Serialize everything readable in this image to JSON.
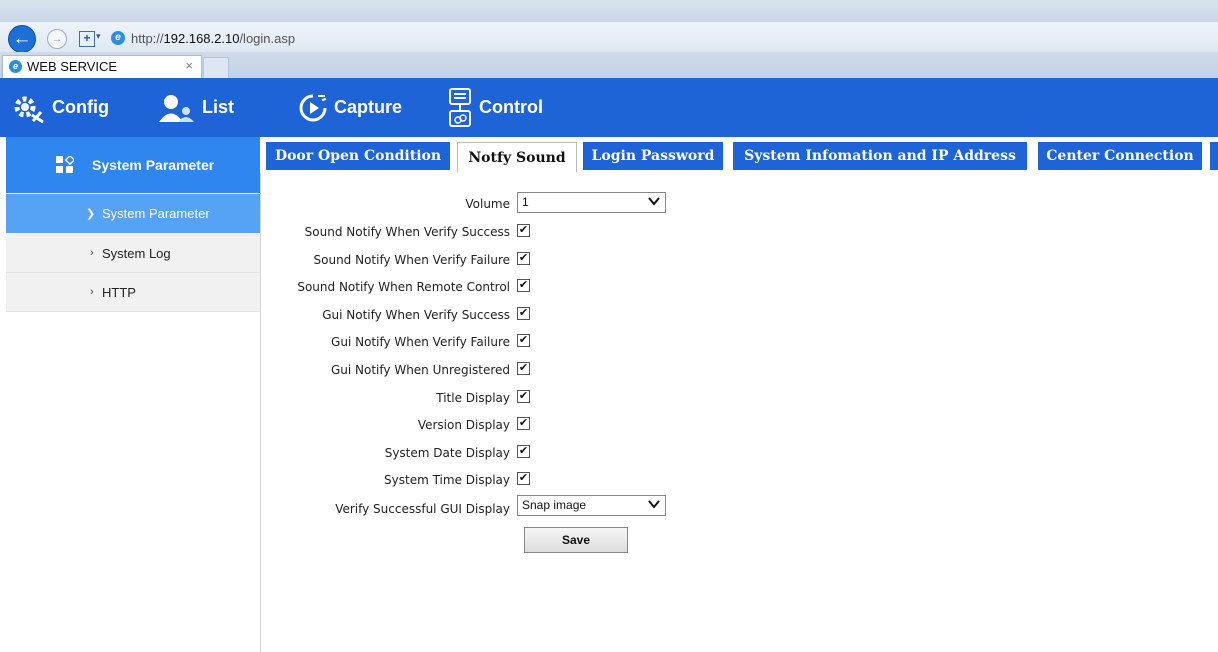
{
  "browser": {
    "url_prefix": "http://",
    "url_host": "192.168.2.10",
    "url_path": "/login.asp",
    "tab_title": "WEB SERVICE",
    "tab_close": "×"
  },
  "nav": {
    "items": [
      {
        "label": "Config",
        "icon": "gear-tools-icon"
      },
      {
        "label": "List",
        "icon": "users-icon"
      },
      {
        "label": "Capture",
        "icon": "capture-icon"
      },
      {
        "label": "Control",
        "icon": "control-icon"
      }
    ],
    "header_color": "#1e64d6"
  },
  "sidebar": {
    "heading": "System Parameter",
    "heading_icon": "grid-icon",
    "active_item": "System Parameter",
    "items": [
      "System Log",
      "HTTP"
    ]
  },
  "tabs": [
    {
      "label": "Door Open Condition",
      "active": false
    },
    {
      "label": "Notfy Sound",
      "active": true
    },
    {
      "label": "Login Password",
      "active": false
    },
    {
      "label": "System Infomation and IP Address",
      "active": false
    },
    {
      "label": "Center Connection",
      "active": false
    }
  ],
  "form": {
    "volume_label": "Volume",
    "volume_value": "1",
    "checkboxes": [
      {
        "label": "Sound Notify When Verify Success",
        "checked": true
      },
      {
        "label": "Sound Notify When Verify Failure",
        "checked": true
      },
      {
        "label": "Sound Notify When Remote Control",
        "checked": true
      },
      {
        "label": "Gui Notify When Verify Success",
        "checked": true
      },
      {
        "label": "Gui Notify When Verify Failure",
        "checked": true
      },
      {
        "label": "Gui Notify When Unregistered",
        "checked": true
      },
      {
        "label": "Title Display",
        "checked": true
      },
      {
        "label": "Version Display",
        "checked": true
      },
      {
        "label": "System Date Display",
        "checked": true
      },
      {
        "label": "System Time Display",
        "checked": true
      }
    ],
    "gui_display_label": "Verify Successful GUI Display",
    "gui_display_value": "Snap image",
    "save_label": "Save",
    "check_mark": "✔"
  }
}
